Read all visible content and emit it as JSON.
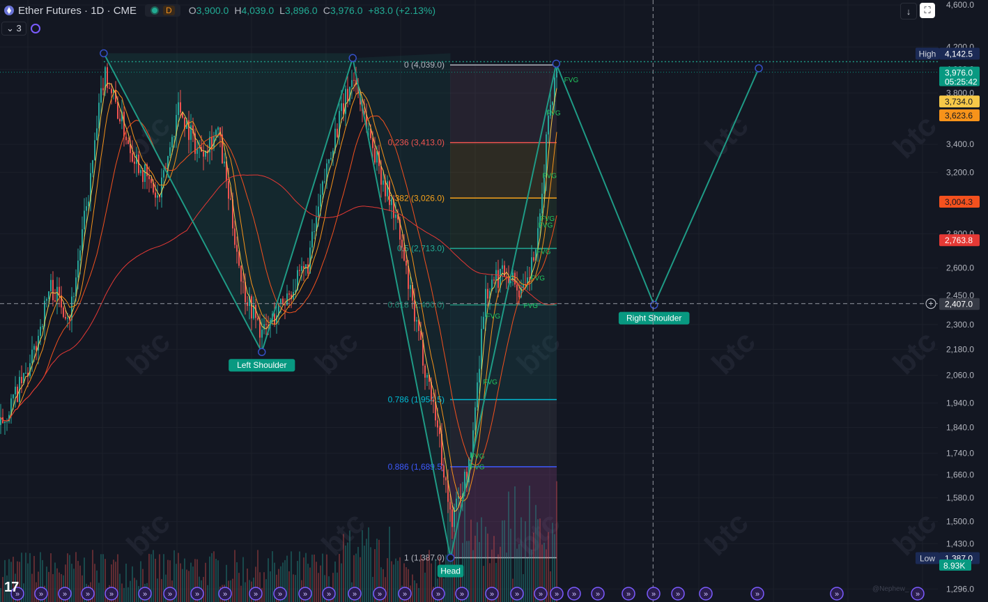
{
  "header": {
    "title": "Ether Futures · 1D · CME",
    "session_badge": "D",
    "ohlc": [
      {
        "k": "O",
        "v": "3,900.0"
      },
      {
        "k": "H",
        "v": "4,039.0"
      },
      {
        "k": "L",
        "v": "3,896.0"
      },
      {
        "k": "C",
        "v": "3,976.0"
      }
    ],
    "change": "+83.0 (+2.13%)",
    "indicator_count": "3"
  },
  "colors": {
    "background": "#131722",
    "up": "#26a69a",
    "down": "#ef5350",
    "pattern": "#1f9b86",
    "accent": "#7b5cff"
  },
  "watermark": "btc",
  "credit": "@Nephew_",
  "chart_data": {
    "type": "candlestick",
    "y_scale": "log",
    "ylim": [
      1260,
      4650
    ],
    "y_ticks": [
      {
        "v": 4600,
        "label": "4,600.0"
      },
      {
        "v": 4200,
        "label": "4,200.0"
      },
      {
        "v": 4000,
        "label": "4,000.0"
      },
      {
        "v": 3800,
        "label": "3,800.0"
      },
      {
        "v": 3400,
        "label": "3,400.0"
      },
      {
        "v": 3200,
        "label": "3,200.0"
      },
      {
        "v": 2800,
        "label": "2,800.0"
      },
      {
        "v": 2600,
        "label": "2,600.0"
      },
      {
        "v": 2450,
        "label": "2,450.0"
      },
      {
        "v": 2300,
        "label": "2,300.0"
      },
      {
        "v": 2180,
        "label": "2,180.0"
      },
      {
        "v": 2060,
        "label": "2,060.0"
      },
      {
        "v": 1940,
        "label": "1,940.0"
      },
      {
        "v": 1840,
        "label": "1,840.0"
      },
      {
        "v": 1740,
        "label": "1,740.0"
      },
      {
        "v": 1660,
        "label": "1,660.0"
      },
      {
        "v": 1580,
        "label": "1,580.0"
      },
      {
        "v": 1500,
        "label": "1,500.0"
      },
      {
        "v": 1430,
        "label": "1,430.0"
      },
      {
        "v": 1296,
        "label": "1,296.0"
      }
    ],
    "price_tags": [
      {
        "v": 4142.5,
        "label": "4,142.5",
        "tag": "High",
        "bg": "#1b2a55",
        "fg": "#ffffff"
      },
      {
        "v": 3976,
        "label": "3,976.0",
        "sub": "05:25:42",
        "bg": "#089981",
        "fg": "#ffffff"
      },
      {
        "v": 3734,
        "label": "3,734.0",
        "bg": "#f7c948",
        "fg": "#131722"
      },
      {
        "v": 3623.6,
        "label": "3,623.6",
        "bg": "#f7931a",
        "fg": "#131722"
      },
      {
        "v": 3004.3,
        "label": "3,004.3",
        "bg": "#f4511e",
        "fg": "#131722"
      },
      {
        "v": 2763.8,
        "label": "2,763.8",
        "bg": "#e53935",
        "fg": "#ffffff"
      },
      {
        "v": 2407,
        "label": "2,407.0",
        "bg": "#363a45",
        "fg": "#ffffff"
      },
      {
        "v": 1387,
        "label": "1,387.0",
        "tag": "Low",
        "bg": "#1b2a55",
        "fg": "#ffffff"
      }
    ],
    "volume_label": "8.93K",
    "fib_levels": [
      {
        "ratio": "0",
        "value": 4039.0,
        "label": "0 (4,039.0)",
        "color": "#b2b5be",
        "fill": "rgba(120,90,110,0.18)"
      },
      {
        "ratio": "0.236",
        "value": 3413.0,
        "label": "0.236 (3,413.0)",
        "color": "#ef5350",
        "fill": "rgba(140,120,40,0.22)"
      },
      {
        "ratio": "0.382",
        "value": 3026.0,
        "label": "0.382 (3,026.0)",
        "color": "#f7a21b",
        "fill": "rgba(60,110,60,0.20)"
      },
      {
        "ratio": "0.5",
        "value": 2713.0,
        "label": "0.5 (2,713.0)",
        "color": "#22ab94",
        "fill": "rgba(40,100,90,0.18)"
      },
      {
        "ratio": "0.618",
        "value": 2400.0,
        "label": "0.618 (2,400.0)",
        "color": "#1b8a74",
        "fill": "rgba(30,110,110,0.20)"
      },
      {
        "ratio": "0.786",
        "value": 1954.5,
        "label": "0.786 (1,954.5)",
        "color": "#00bcd4",
        "fill": "rgba(90,90,100,0.20)"
      },
      {
        "ratio": "0.886",
        "value": 1689.5,
        "label": "0.886 (1,689.5)",
        "color": "#3d5afe",
        "fill": "rgba(150,70,140,0.25)"
      },
      {
        "ratio": "1",
        "value": 1387.0,
        "label": "1 (1,387.0)",
        "color": "#b2b5be"
      }
    ],
    "pattern": {
      "name": "Head and Shoulders",
      "points": [
        {
          "t": 0.105,
          "price": 4142.5
        },
        {
          "t": 0.265,
          "price": 2167,
          "label": "Left Shoulder"
        },
        {
          "t": 0.357,
          "price": 4100
        },
        {
          "t": 0.456,
          "price": 1387,
          "label": "Head"
        },
        {
          "t": 0.563,
          "price": 4050
        },
        {
          "t": 0.662,
          "price": 2400,
          "label": "Right Shoulder"
        },
        {
          "t": 0.768,
          "price": 4010
        }
      ]
    },
    "fvg_labels": [
      {
        "t": 0.571,
        "price": 3890
      },
      {
        "t": 0.553,
        "price": 3620
      },
      {
        "t": 0.549,
        "price": 3160
      },
      {
        "t": 0.547,
        "price": 2880
      },
      {
        "t": 0.545,
        "price": 2840
      },
      {
        "t": 0.543,
        "price": 2680
      },
      {
        "t": 0.537,
        "price": 2530
      },
      {
        "t": 0.53,
        "price": 2385
      },
      {
        "t": 0.492,
        "price": 2330
      },
      {
        "t": 0.489,
        "price": 2020
      },
      {
        "t": 0.476,
        "price": 1720
      },
      {
        "t": 0.476,
        "price": 1680
      }
    ],
    "fvg_text": "FVG",
    "crosshair": {
      "t": 0.661,
      "price": 2407
    },
    "series": [
      {
        "kind": "candles",
        "anchors": [
          {
            "t": 0.0,
            "price": 1850
          },
          {
            "t": 0.03,
            "price": 2100
          },
          {
            "t": 0.05,
            "price": 2500
          },
          {
            "t": 0.07,
            "price": 2350
          },
          {
            "t": 0.09,
            "price": 3100
          },
          {
            "t": 0.105,
            "price": 4000
          },
          {
            "t": 0.13,
            "price": 3400
          },
          {
            "t": 0.16,
            "price": 3000
          },
          {
            "t": 0.18,
            "price": 3700
          },
          {
            "t": 0.2,
            "price": 3350
          },
          {
            "t": 0.22,
            "price": 3500
          },
          {
            "t": 0.245,
            "price": 2500
          },
          {
            "t": 0.265,
            "price": 2250
          },
          {
            "t": 0.29,
            "price": 2450
          },
          {
            "t": 0.31,
            "price": 2600
          },
          {
            "t": 0.335,
            "price": 3400
          },
          {
            "t": 0.357,
            "price": 3950
          },
          {
            "t": 0.38,
            "price": 3300
          },
          {
            "t": 0.4,
            "price": 2900
          },
          {
            "t": 0.42,
            "price": 2300
          },
          {
            "t": 0.44,
            "price": 1900
          },
          {
            "t": 0.456,
            "price": 1500
          },
          {
            "t": 0.475,
            "price": 1700
          },
          {
            "t": 0.49,
            "price": 2450
          },
          {
            "t": 0.51,
            "price": 2600
          },
          {
            "t": 0.53,
            "price": 2450
          },
          {
            "t": 0.545,
            "price": 2800
          },
          {
            "t": 0.555,
            "price": 3700
          },
          {
            "t": 0.563,
            "price": 3976
          }
        ]
      }
    ]
  }
}
